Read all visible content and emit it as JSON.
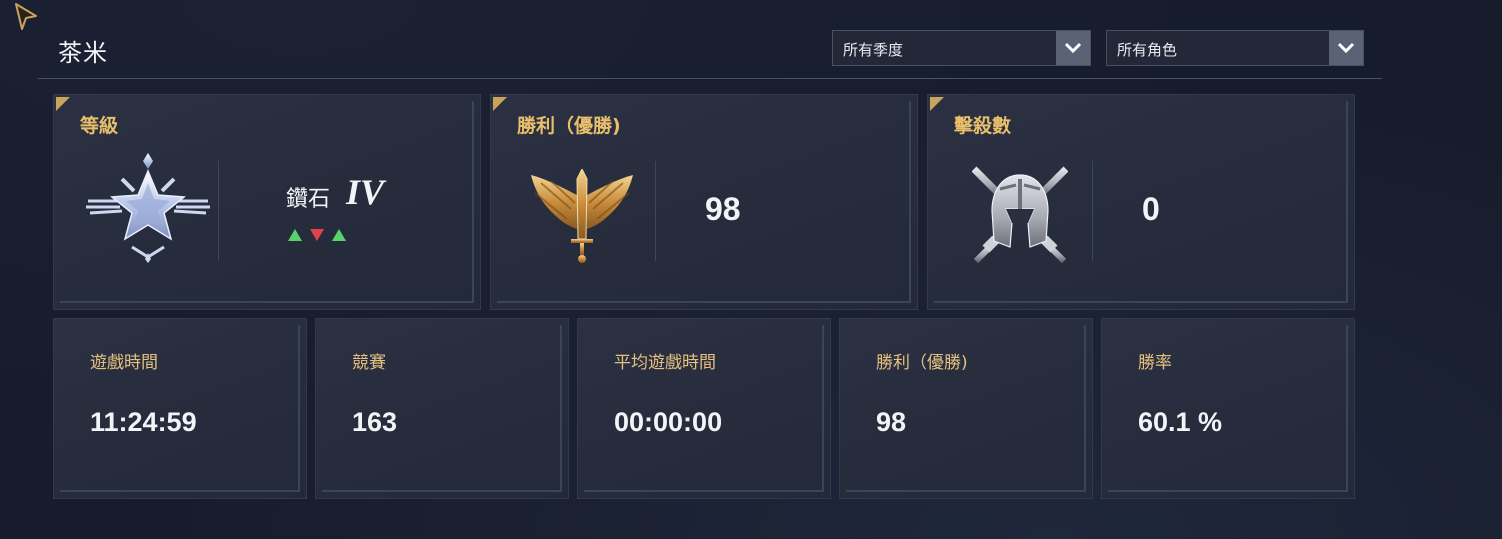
{
  "header": {
    "player_name": "茶米",
    "season_filter": {
      "selected": "所有季度"
    },
    "character_filter": {
      "selected": "所有角色"
    }
  },
  "featured_stats": [
    {
      "title": "等級",
      "icon": "diamond-rank-emblem-icon",
      "rank_name": "鑽石",
      "rank_tier": "IV",
      "recent_results": [
        "up",
        "down",
        "up"
      ]
    },
    {
      "title": "勝利（優勝)",
      "icon": "winged-sword-emblem-icon",
      "value": "98"
    },
    {
      "title": "擊殺數",
      "icon": "spartan-helmet-swords-icon",
      "value": "0"
    }
  ],
  "stats": [
    {
      "title": "遊戲時間",
      "value": "11:24:59"
    },
    {
      "title": "競賽",
      "value": "163"
    },
    {
      "title": "平均遊戲時間",
      "value": "00:00:00"
    },
    {
      "title": "勝利（優勝)",
      "value": "98"
    },
    {
      "title": "勝率",
      "value": "60.1 %"
    }
  ],
  "colors": {
    "accent_gold": "#e8bf6a",
    "up": "#58d36a",
    "down": "#e0414a"
  }
}
